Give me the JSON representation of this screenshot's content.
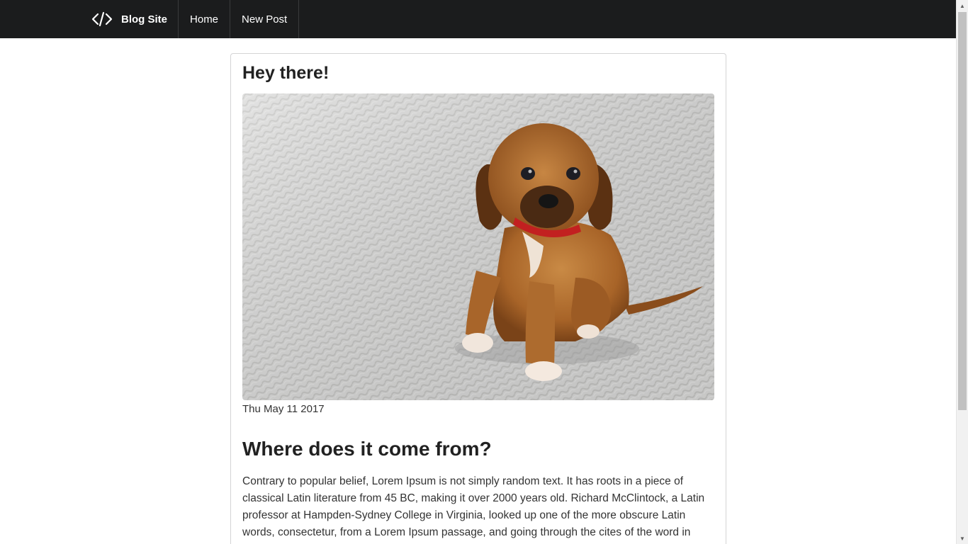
{
  "navbar": {
    "brand_icon": "code-icon",
    "brand_label": "Blog Site",
    "links": [
      "Home",
      "New Post"
    ]
  },
  "post": {
    "title": "Hey there!",
    "image_alt": "puppy-photo",
    "date": "Thu May 11 2017",
    "heading": "Where does it come from?",
    "body": "Contrary to popular belief, Lorem Ipsum is not simply random text. It has roots in a piece of classical Latin literature from 45 BC, making it over 2000 years old. Richard McClintock, a Latin professor at Hampden-Sydney College in Virginia, looked up one of the more obscure Latin words, consectetur, from a Lorem Ipsum passage, and going through the cites of the word in classical literature, discovered the undoubtable source. Lorem Ipsum comes from sections"
  },
  "colors": {
    "navbar_bg": "#1b1c1d",
    "text": "#212121",
    "card_border": "#d4d4d5"
  }
}
